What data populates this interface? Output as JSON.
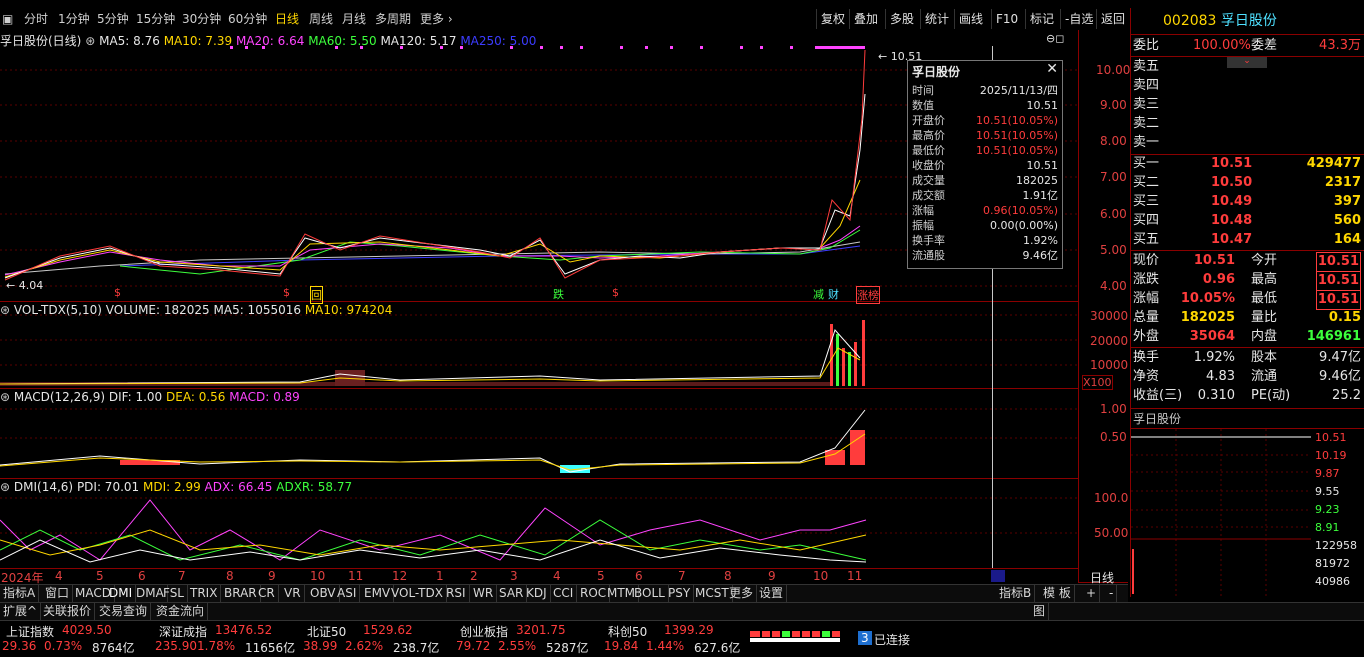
{
  "toolbar": {
    "periods": [
      "分时",
      "1分钟",
      "5分钟",
      "15分钟",
      "30分钟",
      "60分钟",
      "日线",
      "周线",
      "月线",
      "多周期",
      "更多"
    ],
    "active_period": "日线",
    "actions": [
      "复权",
      "叠加",
      "多股",
      "统计",
      "画线",
      "F10",
      "标记",
      "-自选",
      "返回"
    ]
  },
  "legend": {
    "title": "孚日股份(日线)",
    "ma5": "MA5: 8.76",
    "ma10": "MA10: 7.39",
    "ma20": "MA20: 6.64",
    "ma60": "MA60: 5.50",
    "ma120": "MA120: 5.17",
    "ma250": "MA250: 5.00",
    "vol": "VOL-TDX(5,10)",
    "volume": "VOLUME: 182025",
    "vol_ma5": "MA5: 1055016",
    "vol_ma10": "MA10: 974204",
    "macd_name": "MACD(12,26,9)",
    "dif": "DIF: 1.00",
    "dea": "DEA: 0.56",
    "macd": "MACD: 0.89",
    "dmi_name": "DMI(14,6)",
    "pdi": "PDI: 70.01",
    "mdi": "MDI: 2.99",
    "adx": "ADX: 66.45",
    "adxr": "ADXR: 58.77"
  },
  "price_axis": [
    "10.00",
    "9.00",
    "8.00",
    "7.00",
    "6.00",
    "5.00",
    "4.00"
  ],
  "vol_axis": [
    "30000",
    "20000",
    "10000",
    "X100"
  ],
  "macd_axis": [
    "1.00",
    "0.50"
  ],
  "dmi_axis": [
    "100.0",
    "50.00"
  ],
  "price_markers": {
    "high": "10.51",
    "low": "4.04"
  },
  "event_tags": [
    "$",
    "$",
    "回",
    "跌",
    "$",
    "减",
    "财",
    "涨榜"
  ],
  "time_axis": [
    "2024年",
    "4",
    "5",
    "6",
    "7",
    "8",
    "9",
    "10",
    "11",
    "12",
    "1",
    "2",
    "3",
    "4",
    "5",
    "6",
    "7",
    "8",
    "9",
    "10",
    "11"
  ],
  "time_axis_right": "日线",
  "popup": {
    "title": "孚日股份",
    "rows": [
      {
        "label": "时间",
        "value": "2025/11/13/四"
      },
      {
        "label": "数值",
        "value": "10.51"
      },
      {
        "label": "开盘价",
        "value": "10.51(10.05%)"
      },
      {
        "label": "最高价",
        "value": "10.51(10.05%)"
      },
      {
        "label": "最低价",
        "value": "10.51(10.05%)"
      },
      {
        "label": "收盘价",
        "value": "10.51"
      },
      {
        "label": "成交量",
        "value": "182025"
      },
      {
        "label": "成交额",
        "value": "1.91亿"
      },
      {
        "label": "涨幅",
        "value": "0.96(10.05%)"
      },
      {
        "label": "振幅",
        "value": "0.00(0.00%)"
      },
      {
        "label": "换手率",
        "value": "1.92%"
      },
      {
        "label": "流通股",
        "value": "9.46亿"
      }
    ]
  },
  "quote": {
    "code": "002083",
    "name": "孚日股份",
    "weibi_label": "委比",
    "weibi": "100.00%",
    "weicha_label": "委差",
    "weicha": "43.3万",
    "sell": [
      {
        "label": "卖五",
        "price": "",
        "vol": ""
      },
      {
        "label": "卖四",
        "price": "",
        "vol": ""
      },
      {
        "label": "卖三",
        "price": "",
        "vol": ""
      },
      {
        "label": "卖二",
        "price": "",
        "vol": ""
      },
      {
        "label": "卖一",
        "price": "",
        "vol": ""
      }
    ],
    "buy": [
      {
        "label": "买一",
        "price": "10.51",
        "vol": "429477"
      },
      {
        "label": "买二",
        "price": "10.50",
        "vol": "2317"
      },
      {
        "label": "买三",
        "price": "10.49",
        "vol": "397"
      },
      {
        "label": "买四",
        "price": "10.48",
        "vol": "560"
      },
      {
        "label": "买五",
        "price": "10.47",
        "vol": "164"
      }
    ],
    "stats": [
      {
        "l1": "现价",
        "v1": "10.51",
        "l2": "今开",
        "v2": "10.51"
      },
      {
        "l1": "涨跌",
        "v1": "0.96",
        "l2": "最高",
        "v2": "10.51"
      },
      {
        "l1": "涨幅",
        "v1": "10.05%",
        "l2": "最低",
        "v2": "10.51"
      },
      {
        "l1": "总量",
        "v1": "182025",
        "l2": "量比",
        "v2": "0.15"
      },
      {
        "l1": "外盘",
        "v1": "35064",
        "l2": "内盘",
        "v2": "146961"
      }
    ],
    "stats2": [
      {
        "l1": "换手",
        "v1": "1.92%",
        "l2": "股本",
        "v2": "9.47亿"
      },
      {
        "l1": "净资",
        "v1": "4.83",
        "l2": "流通",
        "v2": "9.46亿"
      },
      {
        "l1": "收益(三)",
        "v1": "0.310",
        "l2": "PE(动)",
        "v2": "25.2"
      }
    ],
    "mini_title": "孚日股份",
    "mini_prices": [
      "10.51",
      "10.19",
      "9.87",
      "9.55",
      "9.23",
      "8.91"
    ],
    "mini_vols": [
      "122958",
      "81972",
      "40986"
    ]
  },
  "tabs1": [
    "指标A",
    "窗口",
    "MACD",
    "DMI",
    "DMA",
    "FSL",
    "TRIX",
    "BRAR",
    "CR",
    "VR",
    "OBV",
    "ASI",
    "EMV",
    "VOL-TDX",
    "RSI",
    "WR",
    "SAR",
    "KDJ",
    "CCI",
    "ROC",
    "MTM",
    "BOLL",
    "PSY",
    "MCST",
    "更多",
    "设置"
  ],
  "tabs1_right": [
    "指标B",
    "模 板",
    "+",
    "-"
  ],
  "tabs2": [
    "扩展^",
    "关联报价",
    "交易查询",
    "资金流向"
  ],
  "tabs2_mid": "图",
  "indices": [
    {
      "name": "上证指数",
      "value": "4029.50",
      "chg": "29.36",
      "pct": "0.73%",
      "amt": "8764亿"
    },
    {
      "name": "深证成指",
      "value": "13476.52",
      "chg": "235.90",
      "pct": "1.78%",
      "amt": "11656亿"
    },
    {
      "name": "北证50",
      "value": "1529.62",
      "chg": "38.99",
      "pct": "2.62%",
      "amt": "238.7亿"
    },
    {
      "name": "创业板指",
      "value": "3201.75",
      "chg": "79.72",
      "pct": "2.55%",
      "amt": "5287亿"
    },
    {
      "name": "科创50",
      "value": "1399.29",
      "chg": "19.84",
      "pct": "1.44%",
      "amt": "627.6亿"
    }
  ],
  "connection": {
    "badge": "3",
    "text": "已连接"
  },
  "colors": {
    "up": "#ff3c3c",
    "down": "#3cff3c",
    "ma5": "#ffffff",
    "ma10": "#ffd700",
    "ma20": "#ff44ff",
    "ma60": "#3cff3c",
    "ma120": "#c8c8c8",
    "ma250": "#3c3cff"
  }
}
